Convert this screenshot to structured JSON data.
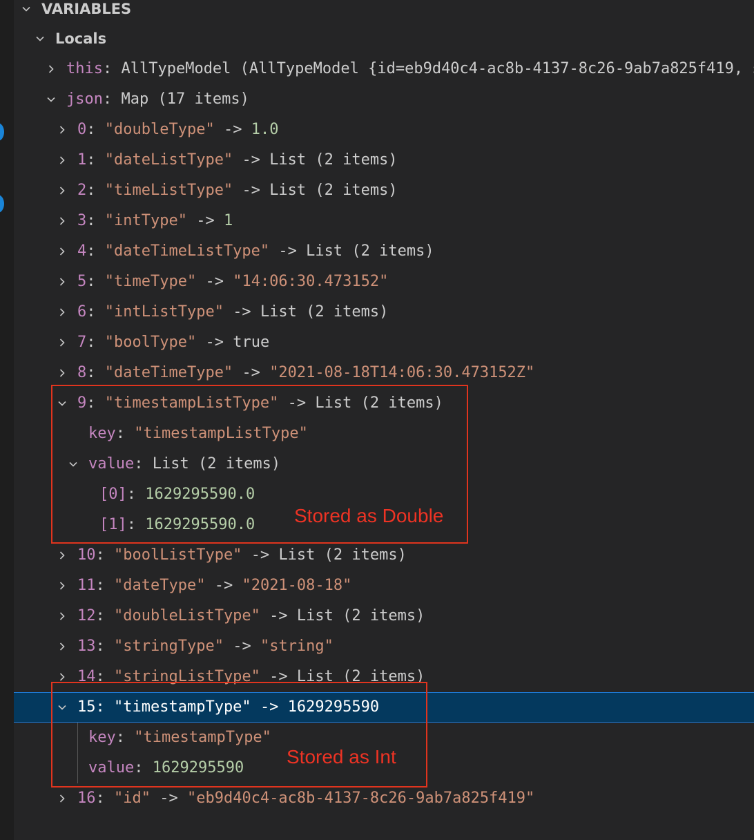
{
  "section_title": "VARIABLES",
  "scope_title": "Locals",
  "this_row": {
    "key": "this",
    "value": "AllTypeModel (AllTypeModel {id=eb9d40c4-ac8b-4137-8c26-9ab7a825f419, s"
  },
  "json_row": {
    "key": "json",
    "value": "Map (17 items)"
  },
  "entries": [
    {
      "idx": "0",
      "key": "\"doubleType\"",
      "arrow": "->",
      "value": "1.0",
      "kind": "n"
    },
    {
      "idx": "1",
      "key": "\"dateListType\"",
      "arrow": "->",
      "value": "List (2 items)",
      "kind": "p"
    },
    {
      "idx": "2",
      "key": "\"timeListType\"",
      "arrow": "->",
      "value": "List (2 items)",
      "kind": "p"
    },
    {
      "idx": "3",
      "key": "\"intType\"",
      "arrow": "->",
      "value": "1",
      "kind": "n"
    },
    {
      "idx": "4",
      "key": "\"dateTimeListType\"",
      "arrow": "->",
      "value": "List (2 items)",
      "kind": "p"
    },
    {
      "idx": "5",
      "key": "\"timeType\"",
      "arrow": "->",
      "value": "\"14:06:30.473152\"",
      "kind": "s"
    },
    {
      "idx": "6",
      "key": "\"intListType\"",
      "arrow": "->",
      "value": "List (2 items)",
      "kind": "p"
    },
    {
      "idx": "7",
      "key": "\"boolType\"",
      "arrow": "->",
      "value": "true",
      "kind": "p"
    },
    {
      "idx": "8",
      "key": "\"dateTimeType\"",
      "arrow": "->",
      "value": "\"2021-08-18T14:06:30.473152Z\"",
      "kind": "s"
    },
    {
      "idx": "9",
      "key": "\"timestampListType\"",
      "arrow": "->",
      "value": "List (2 items)",
      "kind": "p"
    },
    {
      "idx": "10",
      "key": "\"boolListType\"",
      "arrow": "->",
      "value": "List (2 items)",
      "kind": "p"
    },
    {
      "idx": "11",
      "key": "\"dateType\"",
      "arrow": "->",
      "value": "\"2021-08-18\"",
      "kind": "s"
    },
    {
      "idx": "12",
      "key": "\"doubleListType\"",
      "arrow": "->",
      "value": "List (2 items)",
      "kind": "p"
    },
    {
      "idx": "13",
      "key": "\"stringType\"",
      "arrow": "->",
      "value": "\"string\"",
      "kind": "s"
    },
    {
      "idx": "14",
      "key": "\"stringListType\"",
      "arrow": "->",
      "value": "List (2 items)",
      "kind": "p"
    },
    {
      "idx": "15",
      "key": "\"timestampType\"",
      "arrow": "->",
      "value": "1629295590",
      "kind": "n"
    },
    {
      "idx": "16",
      "key": "\"id\"",
      "arrow": "->",
      "value": "\"eb9d40c4-ac8b-4137-8c26-9ab7a825f419\"",
      "kind": "s"
    }
  ],
  "entry9_children": {
    "key_label": "key",
    "key_value": "\"timestampListType\"",
    "value_label": "value",
    "value_value": "List (2 items)",
    "items": [
      {
        "idx": "[0]",
        "value": "1629295590.0"
      },
      {
        "idx": "[1]",
        "value": "1629295590.0"
      }
    ]
  },
  "entry15_children": {
    "key_label": "key",
    "key_value": "\"timestampType\"",
    "value_label": "value",
    "value_value": "1629295590"
  },
  "annotations": {
    "double_note": "Stored as Double",
    "int_note": "Stored as Int",
    "color": "#e0341e"
  },
  "colors": {
    "background": "#252526",
    "selection": "#04395e",
    "key": "#c586c0",
    "string": "#ce9178",
    "number": "#b5cea8"
  }
}
